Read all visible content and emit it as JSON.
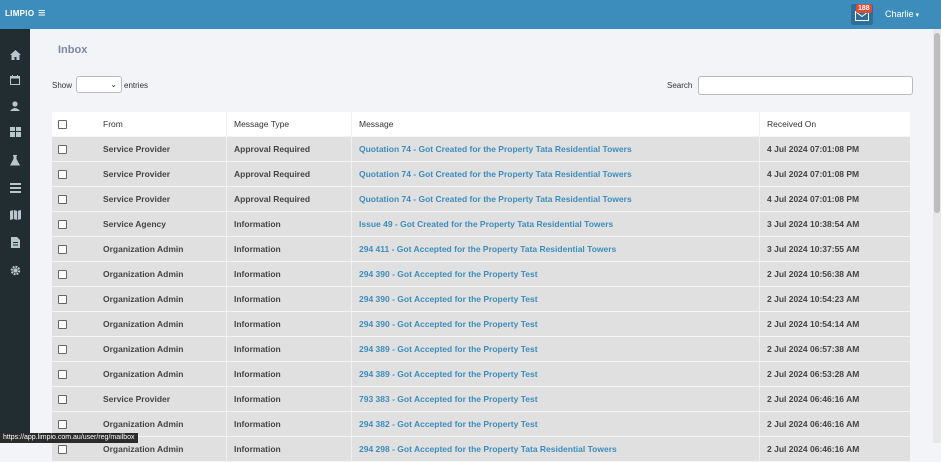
{
  "topbar": {
    "brand": "LIMPIO",
    "menu_icon": "hamburger-icon",
    "mail_badge": "188",
    "user_name": "Charlie",
    "user_caret": "▾"
  },
  "sidebar": {
    "icons": [
      "home-icon",
      "calendar-icon",
      "user-icon",
      "dashboard-icon",
      "flask-icon",
      "list-icon",
      "map-icon",
      "document-icon",
      "gear-icon"
    ]
  },
  "page": {
    "title": "Inbox",
    "show_label": "Show",
    "entries_label": "entries",
    "entries_value": "",
    "search_label": "Search",
    "search_value": ""
  },
  "table": {
    "headers": {
      "from": "From",
      "type": "Message Type",
      "message": "Message",
      "received": "Received On"
    },
    "rows": [
      {
        "from": "Service Provider",
        "type": "Approval Required",
        "message": "Quotation 74 - Got Created for the Property Tata Residential Towers",
        "received": "4 Jul 2024 07:01:08 PM"
      },
      {
        "from": "Service Provider",
        "type": "Approval Required",
        "message": "Quotation 74 - Got Created for the Property Tata Residential Towers",
        "received": "4 Jul 2024 07:01:08 PM"
      },
      {
        "from": "Service Provider",
        "type": "Approval Required",
        "message": "Quotation 74 - Got Created for the Property Tata Residential Towers",
        "received": "4 Jul 2024 07:01:08 PM"
      },
      {
        "from": "Service Agency",
        "type": "Information",
        "message": "Issue 49 - Got Created for the Property Tata Residential Towers",
        "received": "3 Jul 2024 10:38:54 AM"
      },
      {
        "from": "Organization Admin",
        "type": "Information",
        "message": "294 411 - Got Accepted for the Property Tata Residential Towers",
        "received": "3 Jul 2024 10:37:55 AM"
      },
      {
        "from": "Organization Admin",
        "type": "Information",
        "message": "294 390 - Got Accepted for the Property Test",
        "received": "2 Jul 2024 10:56:38 AM"
      },
      {
        "from": "Organization Admin",
        "type": "Information",
        "message": "294 390 - Got Accepted for the Property Test",
        "received": "2 Jul 2024 10:54:23 AM"
      },
      {
        "from": "Organization Admin",
        "type": "Information",
        "message": "294 390 - Got Accepted for the Property Test",
        "received": "2 Jul 2024 10:54:14 AM"
      },
      {
        "from": "Organization Admin",
        "type": "Information",
        "message": "294 389 - Got Accepted for the Property Test",
        "received": "2 Jul 2024 06:57:38 AM"
      },
      {
        "from": "Organization Admin",
        "type": "Information",
        "message": "294 389 - Got Accepted for the Property Test",
        "received": "2 Jul 2024 06:53:28 AM"
      },
      {
        "from": "Service Provider",
        "type": "Information",
        "message": "793 383 - Got Accepted for the Property Test",
        "received": "2 Jul 2024 06:46:16 AM"
      },
      {
        "from": "Organization Admin",
        "type": "Information",
        "message": "294 382 - Got Accepted for the Property Test",
        "received": "2 Jul 2024 06:46:16 AM"
      },
      {
        "from": "Organization Admin",
        "type": "Information",
        "message": "294 298 - Got Accepted for the Property Tata Residential Towers",
        "received": "2 Jul 2024 06:46:16 AM"
      }
    ]
  },
  "status_bar": {
    "url": "https://app.limpio.com.au/user/reg/mailbox"
  },
  "colors": {
    "topbar": "#3c8dbc",
    "sidebar": "#222d32",
    "link": "#3c8dbc",
    "badge": "#dd4b39"
  }
}
